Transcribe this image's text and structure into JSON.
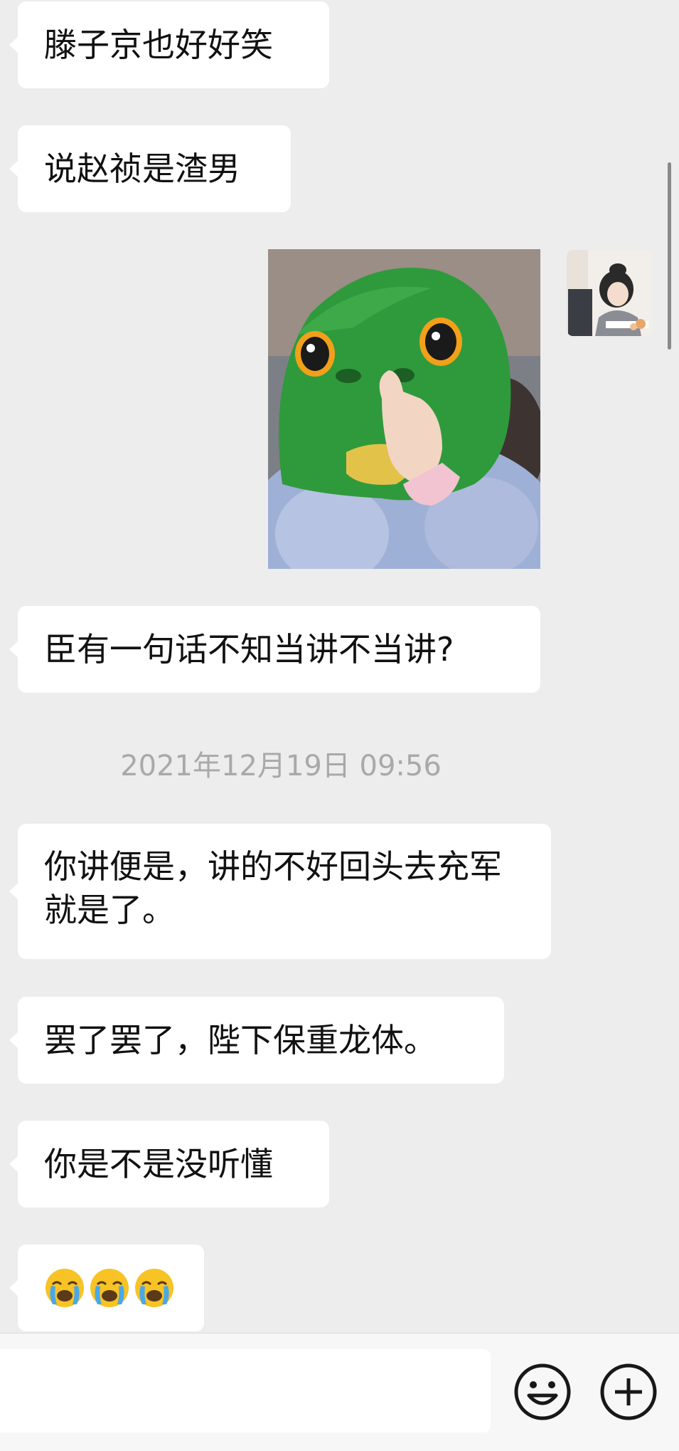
{
  "messages": [
    {
      "text": "滕子京也好好笑"
    },
    {
      "text": "说赵祯是渣男"
    },
    {
      "text": "臣有一句话不知当讲不当讲?"
    },
    {
      "text": "你讲便是，讲的不好回头去充军就是了。"
    },
    {
      "text": "罢了罢了，陛下保重龙体。"
    },
    {
      "text": "你是不是没听懂"
    }
  ],
  "timestamp": "2021年12月19日 09:56",
  "image_message": {
    "subject": "child-in-green-fish-head-mask"
  },
  "emoji_message": {
    "emojis": [
      "loudly-crying-face-icon",
      "loudly-crying-face-icon",
      "loudly-crying-face-icon"
    ]
  },
  "input_bar": {
    "placeholder": "",
    "emoji_button": "smiley-face-icon",
    "more_button": "plus-circle-icon"
  },
  "colors": {
    "background": "#ededed",
    "bubble": "#ffffff",
    "timestamp": "#a9a9a9",
    "fish_mask": "#2f9a3c"
  }
}
